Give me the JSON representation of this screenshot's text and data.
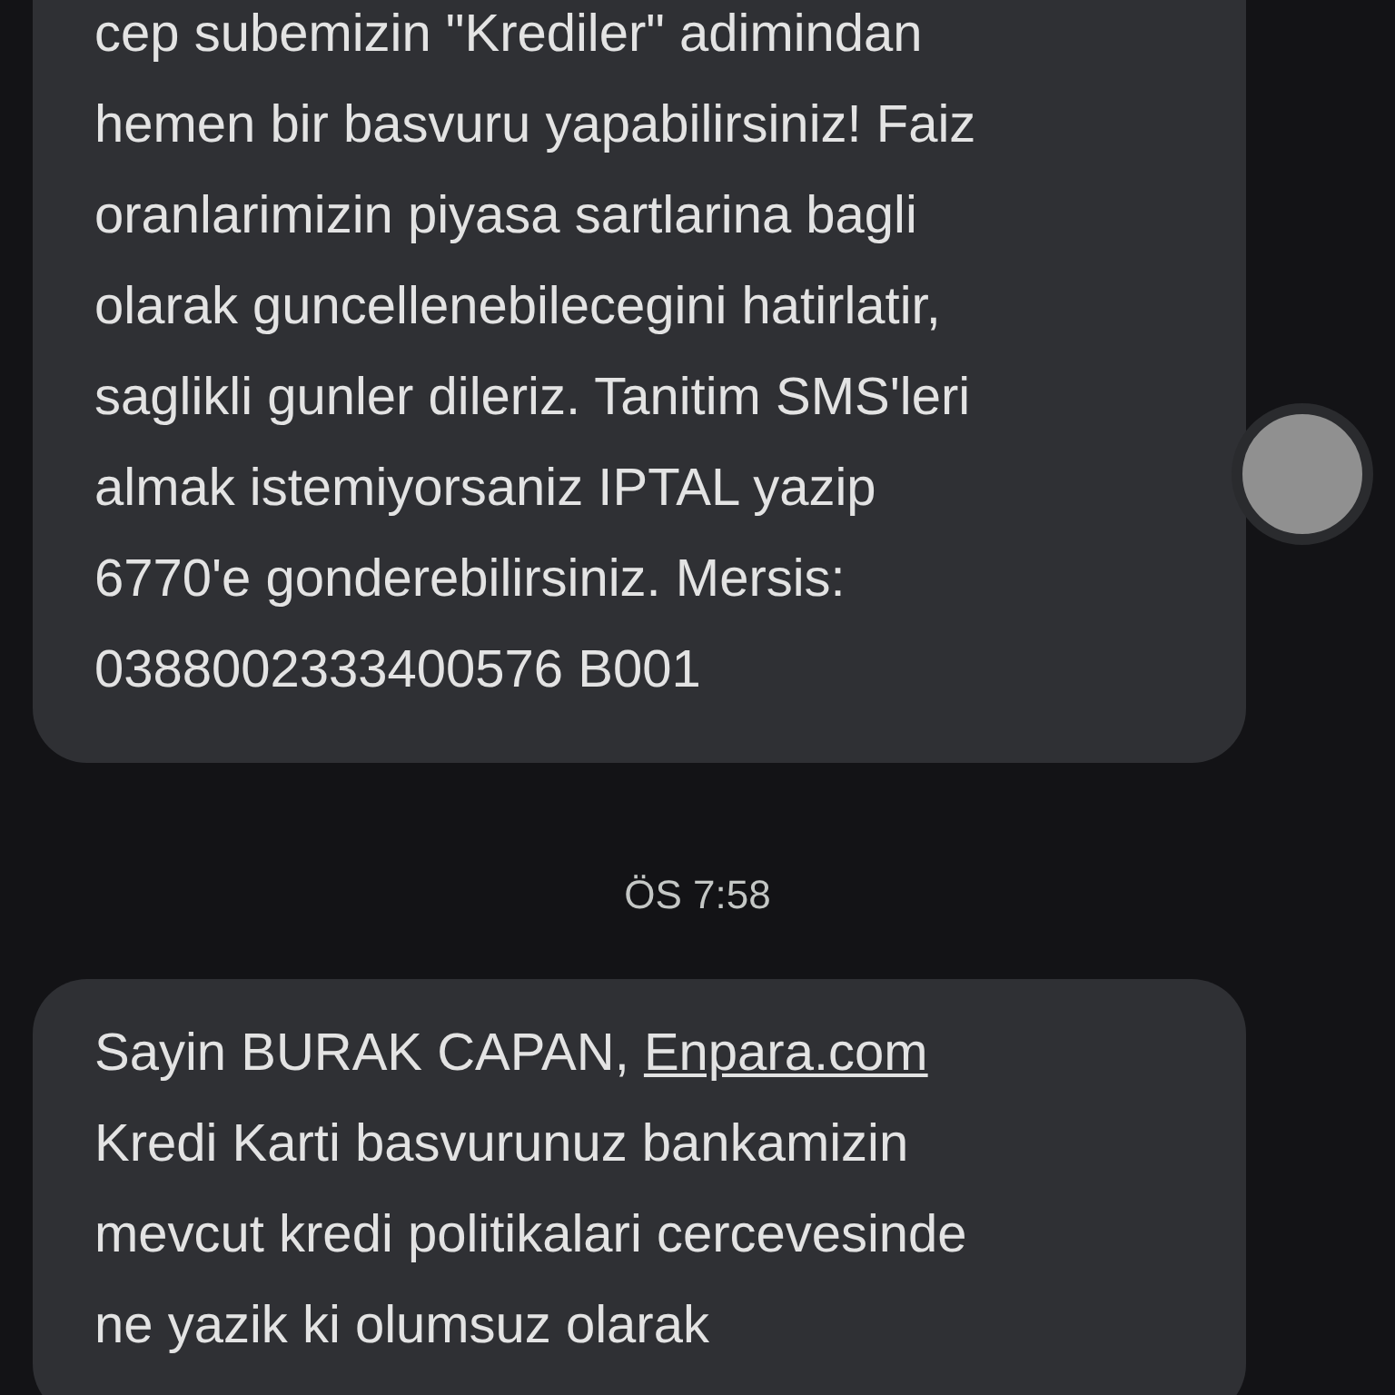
{
  "conversation": [
    {
      "kind": "message",
      "lines": [
        {
          "text": "cep subemizin \"Krediler\" adimindan"
        },
        {
          "text": "hemen bir basvuru yapabilirsiniz! Faiz"
        },
        {
          "text": "oranlarimizin piyasa sartlarina bagli"
        },
        {
          "text": "olarak guncellenebilecegini hatirlatir,"
        },
        {
          "text": "saglikli gunler dileriz. Tanitim SMS'leri"
        },
        {
          "text": "almak istemiyorsaniz IPTAL yazip"
        },
        {
          "text": "6770'e gonderebilirsiniz. Mersis:"
        },
        {
          "text": "0388002333400576 B001"
        }
      ]
    },
    {
      "kind": "timestamp",
      "text": "ÖS 7:58"
    },
    {
      "kind": "message",
      "lines": [
        {
          "text": "Sayin BURAK CAPAN,",
          "link": "Enpara.com"
        },
        {
          "text": "Kredi Karti basvurunuz bankamizin"
        },
        {
          "text": "mevcut kredi politikalari cercevesinde"
        },
        {
          "text": "ne yazik ki olumsuz olarak"
        }
      ]
    }
  ]
}
